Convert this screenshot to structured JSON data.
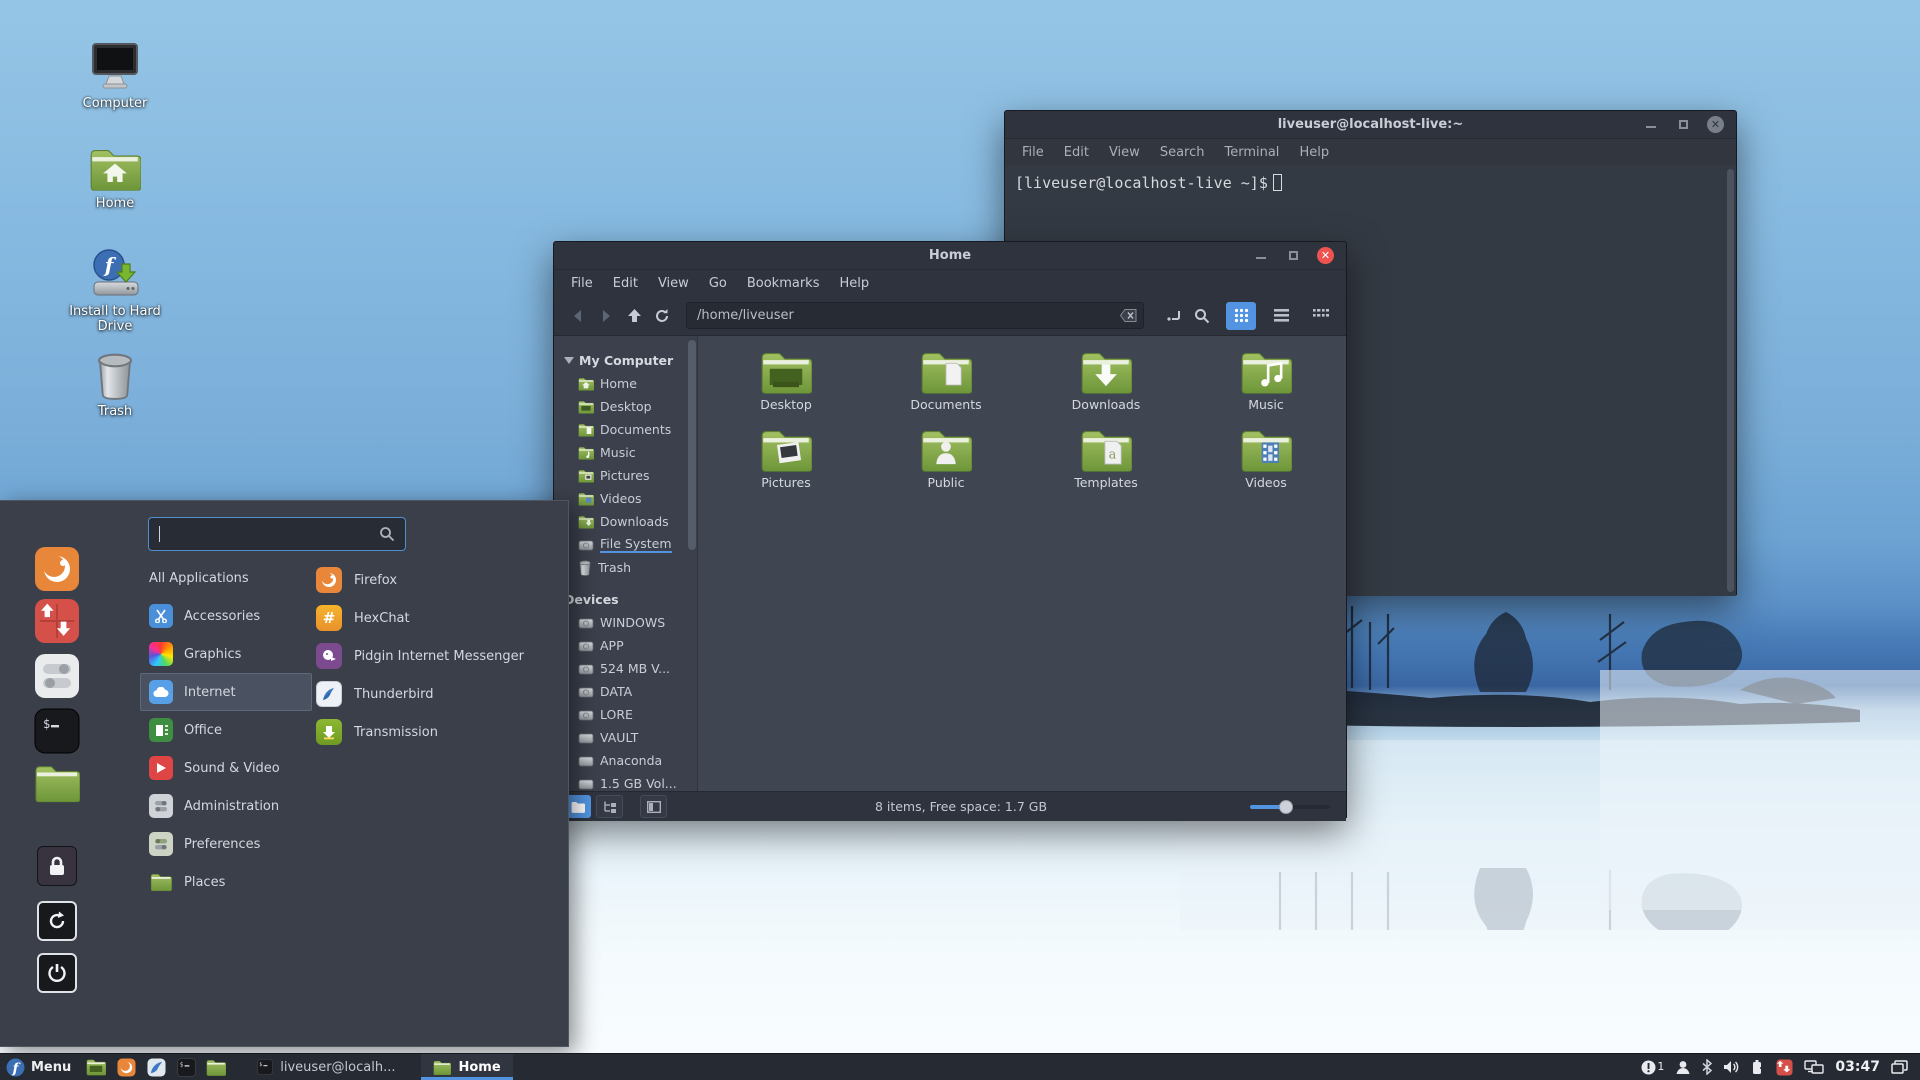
{
  "desktop_icons": [
    {
      "label": "Computer"
    },
    {
      "label": "Home"
    },
    {
      "label": "Install to Hard Drive"
    },
    {
      "label": "Trash"
    }
  ],
  "terminal": {
    "title": "liveuser@localhost-live:~",
    "menu": [
      "File",
      "Edit",
      "View",
      "Search",
      "Terminal",
      "Help"
    ],
    "prompt": "[liveuser@localhost-live ~]$"
  },
  "files_app": {
    "title": "Home",
    "menu": [
      "File",
      "Edit",
      "View",
      "Go",
      "Bookmarks",
      "Help"
    ],
    "path": "/home/liveuser",
    "sidebar_sections": [
      {
        "title": "My Computer",
        "items": [
          {
            "label": "Home"
          },
          {
            "label": "Desktop"
          },
          {
            "label": "Documents"
          },
          {
            "label": "Music"
          },
          {
            "label": "Pictures"
          },
          {
            "label": "Videos"
          },
          {
            "label": "Downloads"
          },
          {
            "label": "File System"
          },
          {
            "label": "Trash"
          }
        ]
      },
      {
        "title": "Devices",
        "items": [
          {
            "label": "WINDOWS"
          },
          {
            "label": "APP"
          },
          {
            "label": "524 MB V..."
          },
          {
            "label": "DATA"
          },
          {
            "label": "LORE"
          },
          {
            "label": "VAULT"
          },
          {
            "label": "Anaconda"
          },
          {
            "label": "1.5 GB Vol..."
          }
        ]
      }
    ],
    "folders": [
      {
        "label": "Desktop"
      },
      {
        "label": "Documents"
      },
      {
        "label": "Downloads"
      },
      {
        "label": "Music"
      },
      {
        "label": "Pictures"
      },
      {
        "label": "Public"
      },
      {
        "label": "Templates"
      },
      {
        "label": "Videos"
      }
    ],
    "status": "8 items, Free space: 1.7 GB"
  },
  "app_menu": {
    "search_value": "",
    "categories": [
      {
        "label": "All Applications"
      },
      {
        "label": "Accessories"
      },
      {
        "label": "Graphics"
      },
      {
        "label": "Internet"
      },
      {
        "label": "Office"
      },
      {
        "label": "Sound & Video"
      },
      {
        "label": "Administration"
      },
      {
        "label": "Preferences"
      },
      {
        "label": "Places"
      }
    ],
    "selected_category": "Internet",
    "apps": [
      {
        "label": "Firefox"
      },
      {
        "label": "HexChat"
      },
      {
        "label": "Pidgin Internet Messenger"
      },
      {
        "label": "Thunderbird"
      },
      {
        "label": "Transmission"
      }
    ]
  },
  "taskbar": {
    "menu_label": "Menu",
    "windows": [
      {
        "label": "liveuser@localh..."
      },
      {
        "label": "Home",
        "active": true
      }
    ],
    "notification_count": "1",
    "clock": "03:47"
  },
  "colors": {
    "accent": "#5294e2",
    "close_red": "#ef5350",
    "folder_green": "#87a556",
    "fedora_blue": "#3c6eb4",
    "update_red": "#d6504a"
  }
}
